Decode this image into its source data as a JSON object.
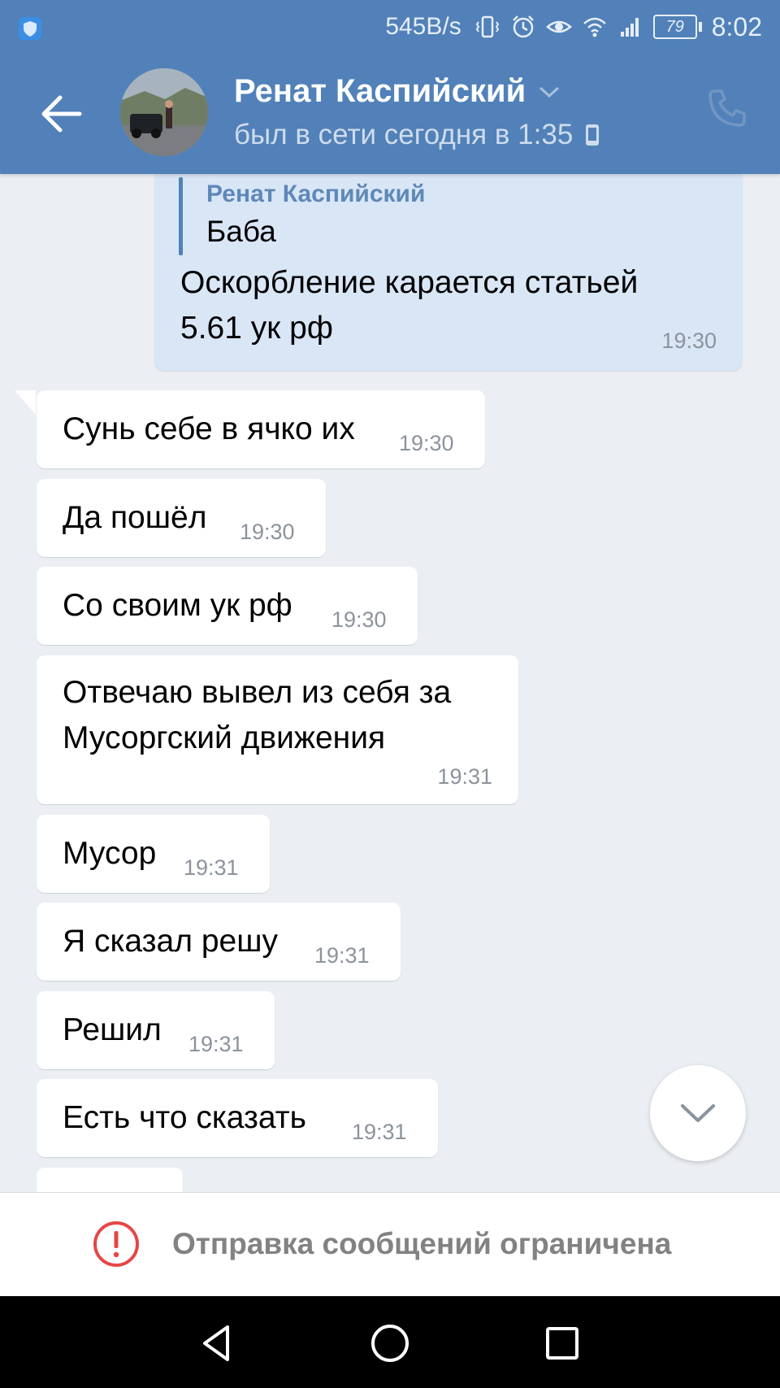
{
  "status_bar": {
    "net_speed": "545B/s",
    "battery": "79",
    "time": "8:02"
  },
  "header": {
    "contact_name": "Ренат Каспийский",
    "last_seen": "был в сети сегодня в 1:35"
  },
  "outgoing": {
    "quote_author": "Ренат Каспийский",
    "quote_text": "Баба",
    "line1": "Оскорбление карается статьей",
    "line2": "5.61 ук рф",
    "time": "19:30"
  },
  "messages": [
    {
      "text": "Сунь себе в ячко их",
      "time": "19:30"
    },
    {
      "text": "Да пошёл",
      "time": "19:30"
    },
    {
      "text": "Со своим ук рф",
      "time": "19:30"
    },
    {
      "text_line1": "Отвечаю вывел из себя за",
      "text_line2": "Мусоргский движения",
      "time": "19:31"
    },
    {
      "text": "Мусор",
      "time": "19:31"
    },
    {
      "text": "Я сказал решу",
      "time": "19:31"
    },
    {
      "text": "Решил",
      "time": "19:31"
    },
    {
      "text": "Есть что сказать",
      "time": "19:31"
    }
  ],
  "restriction": {
    "text": "Отправка сообщений ограничена"
  },
  "colors": {
    "header_blue": "#5181b8",
    "outgoing_bubble": "#d9e6f6",
    "chat_bg": "#ebeef3",
    "error_red": "#e64646"
  },
  "icons": [
    "back-arrow-icon",
    "chevron-down-icon",
    "mobile-phone-icon",
    "call-icon",
    "scroll-down-icon",
    "alert-icon",
    "nav-back-icon",
    "nav-home-icon",
    "nav-recents-icon"
  ]
}
